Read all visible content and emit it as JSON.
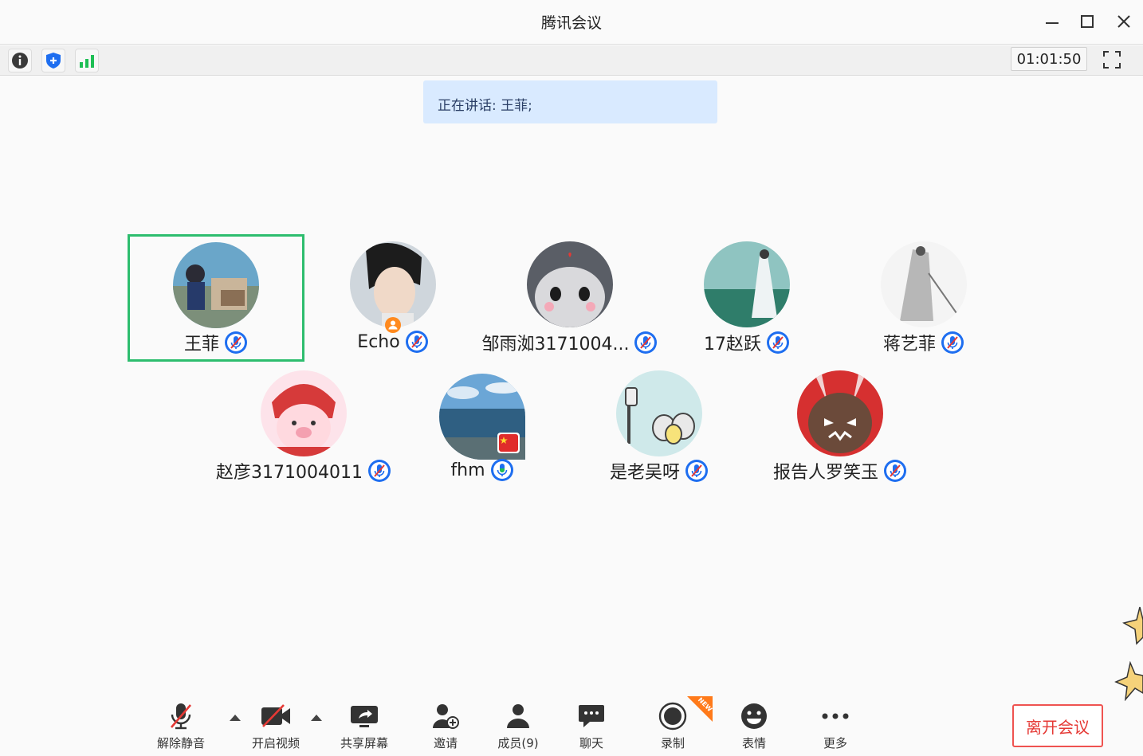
{
  "window": {
    "title": "腾讯会议"
  },
  "infobar": {
    "timer": "01:01:50"
  },
  "speaking": {
    "text": "正在讲话: 王菲;"
  },
  "participants": [
    {
      "name": "王菲",
      "mic": "muted",
      "active": true
    },
    {
      "name": "Echo",
      "mic": "muted",
      "host": true
    },
    {
      "name": "邹雨洳3171004...",
      "mic": "muted"
    },
    {
      "name": "17赵跃",
      "mic": "muted"
    },
    {
      "name": "蒋艺菲",
      "mic": "muted"
    },
    {
      "name": "赵彦3171004011",
      "mic": "muted"
    },
    {
      "name": "fhm",
      "mic": "on"
    },
    {
      "name": "是老吴呀",
      "mic": "muted"
    },
    {
      "name": "报告人罗笑玉",
      "mic": "muted"
    }
  ],
  "toolbar": {
    "unmute": "解除静音",
    "video": "开启视频",
    "share": "共享屏幕",
    "invite": "邀请",
    "members": "成员(9)",
    "chat": "聊天",
    "record": "录制",
    "record_badge": "NEW",
    "emoji": "表情",
    "more": "更多",
    "leave": "离开会议"
  },
  "colors": {
    "accent_blue": "#1e6ef0",
    "active_border": "#2dbd6e",
    "leave_red": "#e53935",
    "speaking_bg": "#d9eaff"
  }
}
